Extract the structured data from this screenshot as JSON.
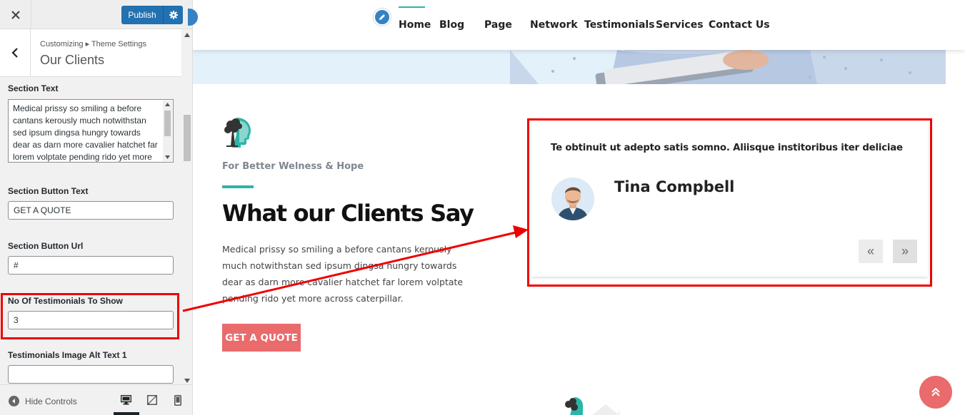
{
  "customizer": {
    "close_icon": "close-icon",
    "publish_label": "Publish",
    "breadcrumb": "Customizing ▸ Theme Settings",
    "panel_title": "Our Clients",
    "controls": {
      "section_text_label": "Section Text",
      "section_text_value": "Medical prissy so smiling a before cantans kerously much notwithstan sed ipsum dingsa hungry towards dear as darn more cavalier hatchet far lorem volptate pending rido yet more across caterpillar.",
      "button_text_label": "Section Button Text",
      "button_text_value": "GET A QUOTE",
      "button_url_label": "Section Button Url",
      "button_url_value": "#",
      "testimonials_count_label": "No Of Testimonials To Show",
      "testimonials_count_value": "3",
      "image_alt_label": "Testimonials Image Alt Text 1",
      "image_alt_value": ""
    },
    "footer": {
      "hide_controls_label": "Hide Controls",
      "devices": [
        "desktop",
        "tablet",
        "mobile"
      ],
      "active_device": "desktop"
    }
  },
  "preview": {
    "nav": {
      "items": [
        "Home",
        "Blog",
        "Page",
        "Network",
        "Testimonials",
        "Services",
        "Contact Us"
      ],
      "active": "Home"
    },
    "section": {
      "tagline": "For Better Welness & Hope",
      "heading": "What our Clients Say",
      "body": "Medical prissy so smiling a before cantans kerously much notwithstan sed ipsum dingsa hungry towards dear as darn more cavalier hatchet far lorem volptate pending rido yet more across caterpillar.",
      "button_label": "GET A QUOTE"
    },
    "testimonial": {
      "quote": "Te obtinuit ut adepto satis somno. Aliisque institoribus iter deliciae",
      "name": "Tina Compbell",
      "prev_label": "«",
      "next_label": "»"
    }
  },
  "colors": {
    "accent_teal": "#2bb5a7",
    "button_red": "#e96b6b",
    "publish_blue": "#2271b1",
    "highlight_red": "#ee0000"
  }
}
